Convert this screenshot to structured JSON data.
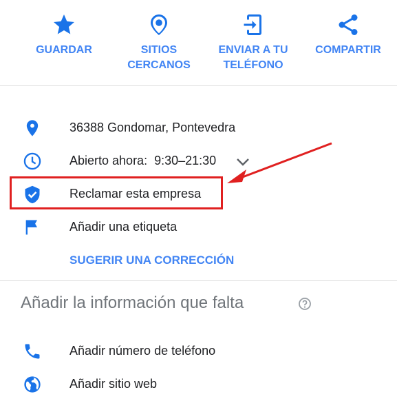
{
  "actions": [
    {
      "icon": "star-icon",
      "label_line1": "GUARDAR",
      "label_line2": ""
    },
    {
      "icon": "nearby-places-icon",
      "label_line1": "SITIOS",
      "label_line2": "CERCANOS"
    },
    {
      "icon": "send-to-phone-icon",
      "label_line1": "ENVIAR A TU",
      "label_line2": "TELÉFONO"
    },
    {
      "icon": "share-icon",
      "label_line1": "COMPARTIR",
      "label_line2": ""
    }
  ],
  "details": {
    "address": "36388 Gondomar, Pontevedra",
    "hours": "Abierto ahora:  9:30–21:30",
    "claim": "Reclamar esta empresa",
    "label": "Añadir una etiqueta",
    "suggest_edit": "SUGERIR UNA CORRECCIÓN"
  },
  "missing": {
    "title": "Añadir la información que falta",
    "phone": "Añadir número de teléfono",
    "website": "Añadir sitio web"
  },
  "colors": {
    "accent": "#4285f4",
    "icon_blue": "#1a73e8",
    "highlight_red": "#e02020",
    "muted": "#70757a"
  }
}
